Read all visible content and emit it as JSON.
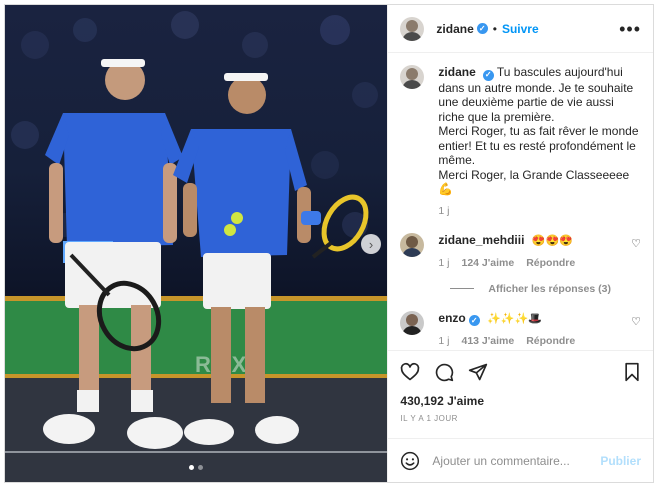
{
  "post": {
    "author": "zidane",
    "follow_label": "Suivre",
    "separator": "•",
    "more_label": "•••",
    "media_next_label": "›"
  },
  "caption": {
    "username": "zidane",
    "lines": [
      "Tu bascules aujourd'hui",
      "dans un autre monde. Je te souhaite",
      "une deuxième partie de vie aussi",
      "riche que la première.",
      "Merci Roger, tu as fait rêver le monde",
      "entier! Et tu es resté profondément le",
      "même.",
      "Merci Roger, la Grande Classeeeee",
      "💪"
    ],
    "time": "1 j"
  },
  "comments": [
    {
      "username": "zidane_mehdiii",
      "text": "😍😍😍",
      "time": "1 j",
      "likes": "124 J'aime",
      "reply_label": "Répondre",
      "replies_label": "Afficher les réponses (3)"
    },
    {
      "username": "enzo",
      "verified": true,
      "text": "✨✨✨🎩",
      "time": "1 j",
      "likes": "413 J'aime",
      "reply_label": "Répondre"
    }
  ],
  "stats": {
    "likes": "430,192 J'aime",
    "time_ago": "IL Y A 1 JOUR"
  },
  "composer": {
    "placeholder": "Ajouter un commentaire...",
    "publish_label": "Publier"
  },
  "icons": {
    "like": "heart-icon",
    "comment": "comment-icon",
    "share": "share-icon",
    "save": "bookmark-icon",
    "emoji": "emoji-icon",
    "verified": "verified-badge-icon",
    "more": "more-icon",
    "next": "chevron-right-icon"
  },
  "colors": {
    "link_blue": "#0095f6",
    "verified_blue": "#3897f0",
    "publish_disabled": "#b2dffc",
    "muted": "#8e8e8e"
  },
  "carousel": {
    "total": 2,
    "active": 1
  }
}
